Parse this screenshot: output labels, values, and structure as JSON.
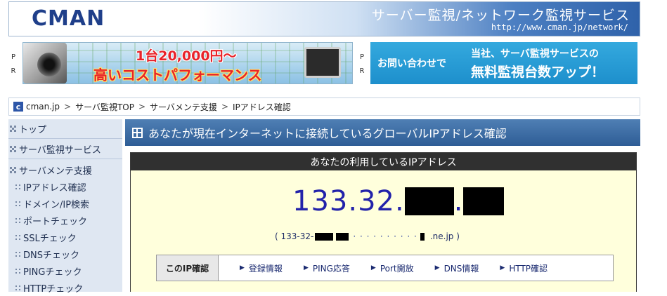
{
  "header": {
    "logo": "CMAN",
    "title": "サーバー監視/ネットワーク監視サービス",
    "url": "http://www.cman.jp/network/"
  },
  "pr": {
    "label": "P\nR"
  },
  "banner_left": {
    "line1": "1台20,000円～",
    "line2": "高いコストパフォーマンス"
  },
  "banner_right": {
    "left": "お問い合わせで",
    "line1": "当社、サーバ監視サービスの",
    "line2": "無料監視台数アップ！"
  },
  "breadcrumb": {
    "logo": "c",
    "items": [
      "cman.jp",
      "サーバ監視TOP",
      "サーバメンテ支援",
      "IPアドレス確認"
    ],
    "separator": ">"
  },
  "sidebar": {
    "main_items": [
      "トップ",
      "サーバ監視サービス",
      "サーバメンテ支援"
    ],
    "sub_items": [
      "IPアドレス確認",
      "ドメイン/IP検索",
      "ポートチェック",
      "SSLチェック",
      "DNSチェック",
      "PINGチェック",
      "HTTPチェック"
    ]
  },
  "main": {
    "section_title": "あなたが現在インターネットに接続しているグローバルIPアドレス確認",
    "box_header": "あなたの利用しているIPアドレス",
    "ip_prefix": "133.32.",
    "ip_dot": ".",
    "host_prefix": "( 133-32-",
    "host_suffix": ".ne.jp )",
    "host_dots": "· · · · · · · · · ·",
    "check_label": "このIP確認",
    "check_links": [
      "登録情報",
      "PING応答",
      "Port開放",
      "DNS情報",
      "HTTP確認"
    ]
  }
}
